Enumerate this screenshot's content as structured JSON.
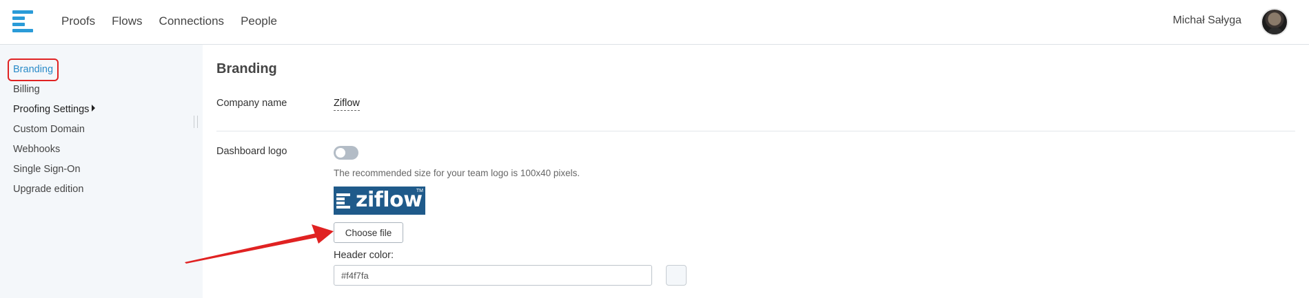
{
  "app": {
    "nav": [
      "Proofs",
      "Flows",
      "Connections",
      "People"
    ],
    "user_name": "Michał Sałyga"
  },
  "sidebar": {
    "items": [
      {
        "label": "Branding",
        "active": true
      },
      {
        "label": "Billing"
      },
      {
        "label": "Proofing Settings",
        "has_submenu": true
      },
      {
        "label": "Custom Domain"
      },
      {
        "label": "Webhooks"
      },
      {
        "label": "Single Sign-On"
      },
      {
        "label": "Upgrade edition"
      }
    ]
  },
  "main": {
    "title": "Branding",
    "company_name_label": "Company name",
    "company_name_value": "Ziflow",
    "dashboard_logo_label": "Dashboard logo",
    "dashboard_logo_enabled": false,
    "logo_hint": "The recommended size for your team logo is 100x40 pixels.",
    "logo_wordmark": "ziflow",
    "logo_tm": "TM",
    "choose_file_label": "Choose file",
    "header_color_label": "Header color:",
    "header_color_value": "#f4f7fa"
  },
  "colors": {
    "accent": "#2a8bc8",
    "brand_blue": "#1f5a8a",
    "sidebar_bg": "#f4f7fa",
    "annotation_red": "#e02222"
  },
  "icons": {
    "logo": "ziflow-logo-icon",
    "submenu": "caret-right-icon",
    "annotation": "red-arrow-icon"
  }
}
